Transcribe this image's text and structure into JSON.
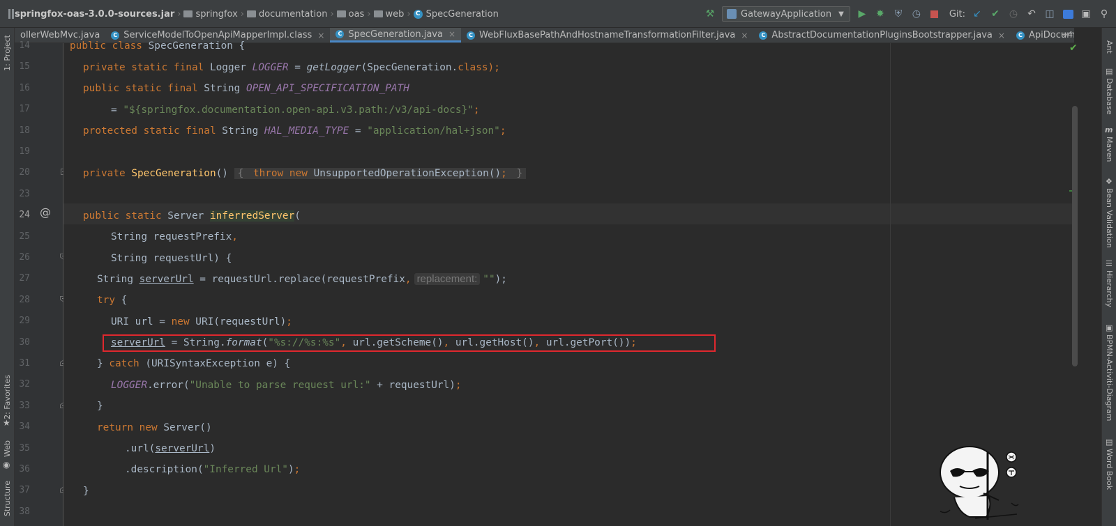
{
  "breadcrumb": {
    "items": [
      "springfox-oas-3.0.0-sources.jar",
      "springfox",
      "documentation",
      "oas",
      "web",
      "SpecGeneration"
    ]
  },
  "toolbar": {
    "run_config": "GatewayApplication",
    "git_label": "Git:"
  },
  "tabs": [
    {
      "label": "ollerWebMvc.java",
      "active": false,
      "closable": false
    },
    {
      "label": "ServiceModelToOpenApiMapperImpl.class",
      "active": false,
      "closable": true
    },
    {
      "label": "SpecGeneration.java",
      "active": true,
      "closable": true
    },
    {
      "label": "WebFluxBasePathAndHostnameTransformationFilter.java",
      "active": false,
      "closable": true
    },
    {
      "label": "AbstractDocumentationPluginsBootstrapper.java",
      "active": false,
      "closable": true
    },
    {
      "label": "ApiDocumentationScanner.java",
      "active": false,
      "closable": true
    }
  ],
  "tabs_more": "≡4",
  "left_tool_windows": [
    "1: Project",
    "2: Favorites",
    "Web",
    "Structure"
  ],
  "right_tool_windows": [
    "Ant",
    "Database",
    "Maven",
    "Bean Validation",
    "Hierarchy",
    "BPMN-Activiti-Diagram",
    "Word Book"
  ],
  "line_numbers": [
    "14",
    "15",
    "16",
    "17",
    "18",
    "19",
    "20",
    "23",
    "24",
    "25",
    "26",
    "27",
    "28",
    "29",
    "30",
    "31",
    "32",
    "33",
    "34",
    "35",
    "36",
    "37",
    "38"
  ],
  "code": {
    "l14": {
      "a": "public class ",
      "b": "SpecGeneration {"
    },
    "l15": {
      "a": "private static final ",
      "b": "Logger ",
      "c": "LOGGER",
      "d": " = ",
      "e": "getLogger",
      "f": "(SpecGeneration.",
      "g": "class",
      "h": ");"
    },
    "l16": {
      "a": "public static final ",
      "b": "String ",
      "c": "OPEN_API_SPECIFICATION_PATH"
    },
    "l17": {
      "a": "= ",
      "b": "\"${springfox.documentation.open-api.v3.path:/v3/api-docs}\"",
      "c": ";"
    },
    "l18": {
      "a": "protected static final ",
      "b": "String ",
      "c": "HAL_MEDIA_TYPE",
      "d": " = ",
      "e": "\"application/hal+json\"",
      "f": ";"
    },
    "l20": {
      "a": "private ",
      "b": "SpecGeneration",
      "c": "() ",
      "d": "{ ",
      "e": "throw new ",
      "f": "UnsupportedOperationException()",
      "g": "; ",
      "h": "}"
    },
    "l24": {
      "a": "public static ",
      "b": "Server ",
      "c": "inferredServer",
      "d": "("
    },
    "l25": {
      "a": "String requestPrefix",
      "b": ","
    },
    "l26": {
      "a": "String requestUrl) {"
    },
    "l27": {
      "a": "String ",
      "b": "serverUrl",
      "c": " = requestUrl.replace(requestPrefix",
      "d": ",",
      "hint": "replacement:",
      "e": "\"\"",
      "f": ");"
    },
    "l28": {
      "a": "try",
      "b": " {"
    },
    "l29": {
      "a": "URI url = ",
      "b": "new ",
      "c": "URI(requestUrl)",
      "d": ";"
    },
    "l30": {
      "a": "serverUrl",
      "b": " = String.",
      "c": "format",
      "d": "(",
      "e": "\"%s://%s:%s\"",
      "f": ", ",
      "g": "url.getScheme()",
      "h": ", ",
      "i": "url.getHost()",
      "j": ", ",
      "k": "url.getPort())",
      "l": ";"
    },
    "l31": {
      "a": "} ",
      "b": "catch ",
      "c": "(URISyntaxException e) {"
    },
    "l32": {
      "a": "LOGGER",
      "b": ".error(",
      "c": "\"Unable to parse request url:\"",
      "d": " + requestUrl)",
      "e": ";"
    },
    "l33": {
      "a": "}"
    },
    "l34": {
      "a": "return new ",
      "b": "Server()"
    },
    "l35": {
      "a": ".url(",
      "b": "serverUrl",
      "c": ")"
    },
    "l36": {
      "a": ".description(",
      "b": "\"Inferred Url\"",
      "c": ")",
      "d": ";"
    },
    "l37": {
      "a": "}"
    }
  },
  "colors": {
    "background": "#2b2b2b",
    "keyword": "#cc7832",
    "string": "#6a8759",
    "constant": "#9876aa",
    "method_decl": "#ffc66d",
    "highlight_box": "#e0282e"
  }
}
